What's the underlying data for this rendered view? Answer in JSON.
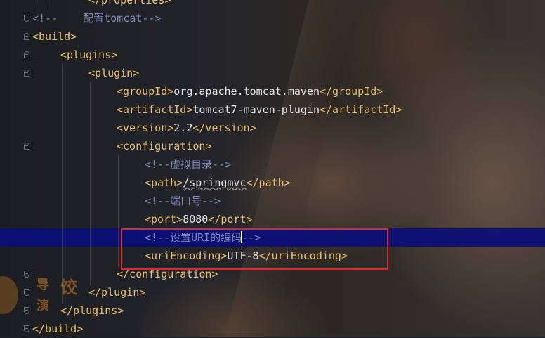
{
  "editor": {
    "lines": [
      {
        "indent": 2,
        "parts": [
          {
            "c": "tag",
            "t": "</properties>"
          }
        ]
      },
      {
        "indent": 0,
        "parts": [
          {
            "c": "cmt",
            "t": "<!--    配置tomcat-->"
          }
        ]
      },
      {
        "indent": 0,
        "parts": [
          {
            "c": "tag",
            "t": "<build>"
          }
        ]
      },
      {
        "indent": 1,
        "parts": [
          {
            "c": "tag",
            "t": "<plugins>"
          }
        ]
      },
      {
        "indent": 2,
        "parts": [
          {
            "c": "tag",
            "t": "<plugin>"
          }
        ]
      },
      {
        "indent": 3,
        "parts": [
          {
            "c": "tag",
            "t": "<groupId>"
          },
          {
            "c": "txt",
            "t": "org.apache.tomcat.maven"
          },
          {
            "c": "tag",
            "t": "</groupId>"
          }
        ]
      },
      {
        "indent": 3,
        "parts": [
          {
            "c": "tag",
            "t": "<artifactId>"
          },
          {
            "c": "txt",
            "t": "tomcat7-maven-plugin"
          },
          {
            "c": "tag",
            "t": "</artifactId>"
          }
        ]
      },
      {
        "indent": 3,
        "parts": [
          {
            "c": "tag",
            "t": "<version>"
          },
          {
            "c": "txt",
            "t": "2.2"
          },
          {
            "c": "tag",
            "t": "</version>"
          }
        ]
      },
      {
        "indent": 3,
        "parts": [
          {
            "c": "tag",
            "t": "<configuration>"
          }
        ]
      },
      {
        "indent": 4,
        "parts": [
          {
            "c": "cmt",
            "t": "<!--虚拟目录-->"
          }
        ]
      },
      {
        "indent": 4,
        "parts": [
          {
            "c": "tag",
            "t": "<path>"
          },
          {
            "c": "txt",
            "t": "/springmvc",
            "u": true
          },
          {
            "c": "tag",
            "t": "</path>"
          }
        ]
      },
      {
        "indent": 4,
        "parts": [
          {
            "c": "cmt",
            "t": "<!--端口号-->"
          }
        ]
      },
      {
        "indent": 4,
        "parts": [
          {
            "c": "tag",
            "t": "<port>"
          },
          {
            "c": "txt",
            "t": "8080"
          },
          {
            "c": "tag",
            "t": "</port>"
          }
        ]
      },
      {
        "indent": 4,
        "parts": [
          {
            "c": "cmt",
            "t": "<!--设置URI的编码"
          },
          {
            "c": "caret",
            "t": ""
          },
          {
            "c": "cmt",
            "t": "-->"
          }
        ]
      },
      {
        "indent": 4,
        "parts": [
          {
            "c": "tag",
            "t": "<uriEncoding>"
          },
          {
            "c": "txt",
            "t": "UTF-8"
          },
          {
            "c": "tag",
            "t": "</uriEncoding>"
          }
        ]
      },
      {
        "indent": 3,
        "parts": [
          {
            "c": "tag",
            "t": "</configuration>"
          }
        ]
      },
      {
        "indent": 2,
        "parts": [
          {
            "c": "tag",
            "t": "</plugin>"
          }
        ]
      },
      {
        "indent": 1,
        "parts": [
          {
            "c": "tag",
            "t": "</plugins>"
          }
        ]
      },
      {
        "indent": 0,
        "parts": [
          {
            "c": "tag",
            "t": "</build>"
          }
        ]
      }
    ]
  },
  "watermark": {
    "chars": [
      "导",
      "饺",
      "演"
    ]
  },
  "colors": {
    "tag": "#e8bf6a",
    "comment": "#7f86ba",
    "text": "#e6e6e6",
    "current_line": "#0a0e78",
    "annotation_box": "#e0262b"
  }
}
